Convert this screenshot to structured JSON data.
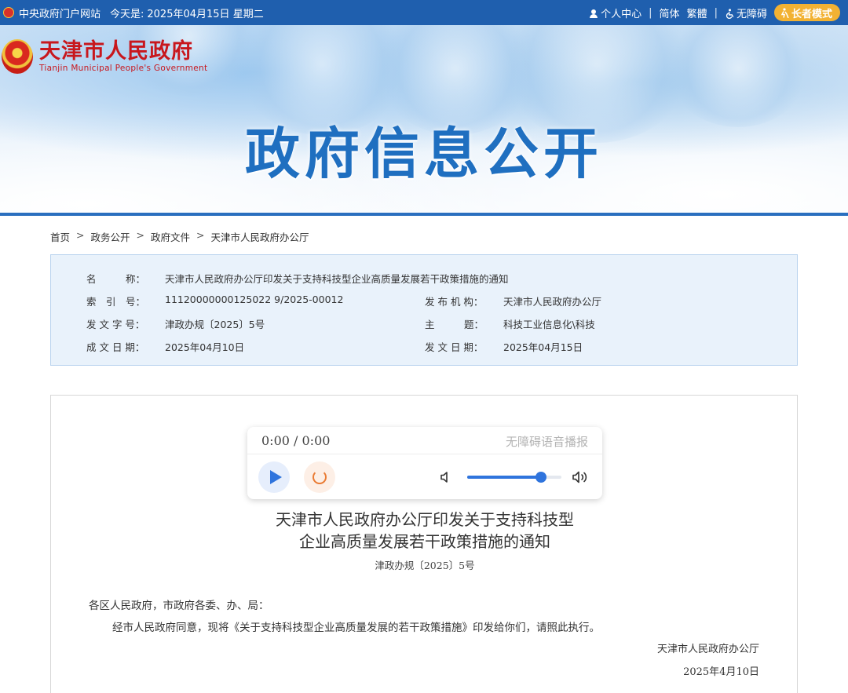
{
  "topbar": {
    "central_portal": "中央政府门户网站",
    "today_label": "今天是:",
    "date": "2025年04月15日 星期二",
    "user_center": "个人中心",
    "simplified": "简体",
    "traditional": "繁體",
    "accessibility": "无障碍",
    "elder_mode": "长者模式",
    "separator": "|"
  },
  "logo": {
    "cn": "天津市人民政府",
    "en": "Tianjin Municipal People's Government"
  },
  "banner": {
    "title": "政府信息公开"
  },
  "breadcrumb": {
    "items": [
      "首页",
      "政务公开",
      "政府文件",
      "天津市人民政府办公厅"
    ],
    "arrow": ">"
  },
  "meta": {
    "name_label": "名　　　称：",
    "name_value": "天津市人民政府办公厅印发关于支持科技型企业高质量发展若干政策措施的通知",
    "index_label": "索　引　号：",
    "index_value": "11120000000125022 9/2025-00012",
    "issuer_label": "发 布 机 构：",
    "issuer_value": "天津市人民政府办公厅",
    "docno_label": "发 文 字 号：",
    "docno_value": "津政办规〔2025〕5号",
    "topic_label": "主　　　题：",
    "topic_value": "科技工业信息化\\科技",
    "created_label": "成 文 日 期：",
    "created_value": "2025年04月10日",
    "published_label": "发 文 日 期：",
    "published_value": "2025年04月15日"
  },
  "player": {
    "time": "0:00 / 0:00",
    "title": "无障碍语音播报",
    "volume_level": 0.78
  },
  "document": {
    "title_line1": "天津市人民政府办公厅印发关于支持科技型",
    "title_line2": "企业高质量发展若干政策措施的通知",
    "number": "津政办规〔2025〕5号",
    "salutation": "各区人民政府，市政府各委、办、局：",
    "body": "经市人民政府同意，现将《关于支持科技型企业高质量发展的若干政策措施》印发给你们，请照此执行。",
    "signature": "天津市人民政府办公厅",
    "sign_date": "2025年4月10日"
  },
  "colors": {
    "topbar": "#1f5fae",
    "title_blue": "#1f6fc0",
    "logo_red": "#c8171d",
    "elder_btn": "#f2b233",
    "player_blue": "#2f74dd",
    "loop_orange": "#ea7b33"
  }
}
